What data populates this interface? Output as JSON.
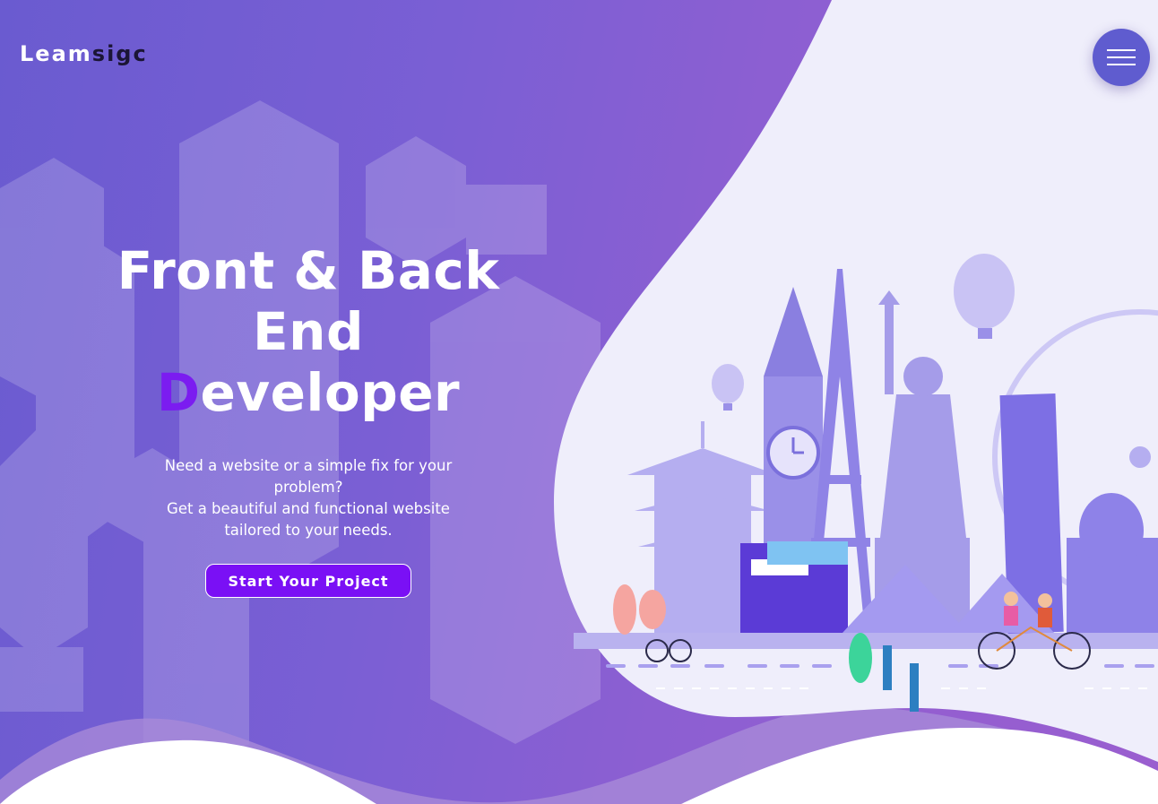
{
  "brand": {
    "part1": "Leam",
    "part2": "sigc"
  },
  "menu": {
    "icon": "hamburger-menu-icon"
  },
  "hero": {
    "title_line1": "Front & Back",
    "title_line2": "End",
    "title_accent": "D",
    "title_rest": "eveloper",
    "description_line1": "Need a website or a simple fix for your problem?",
    "description_line2": "Get a beautiful and functional website",
    "description_line3": "tailored to your needs.",
    "cta_label": "Start Your Project"
  },
  "colors": {
    "accent": "#7b1cf0",
    "button": "#7a10f5",
    "menu_button": "#5f5ccf",
    "background_start": "#6a5bd0",
    "background_end": "#9a5ecf"
  },
  "illustration": {
    "subject": "world-landmarks-travel-illustration",
    "icons": [
      "hot-air-balloon-icon",
      "statue-of-liberty-icon",
      "big-ben-icon",
      "eiffel-tower-icon",
      "ferris-wheel-icon",
      "pagoda-icon",
      "leaning-tower-icon",
      "cyclist-icon",
      "tandem-bike-icon"
    ]
  }
}
